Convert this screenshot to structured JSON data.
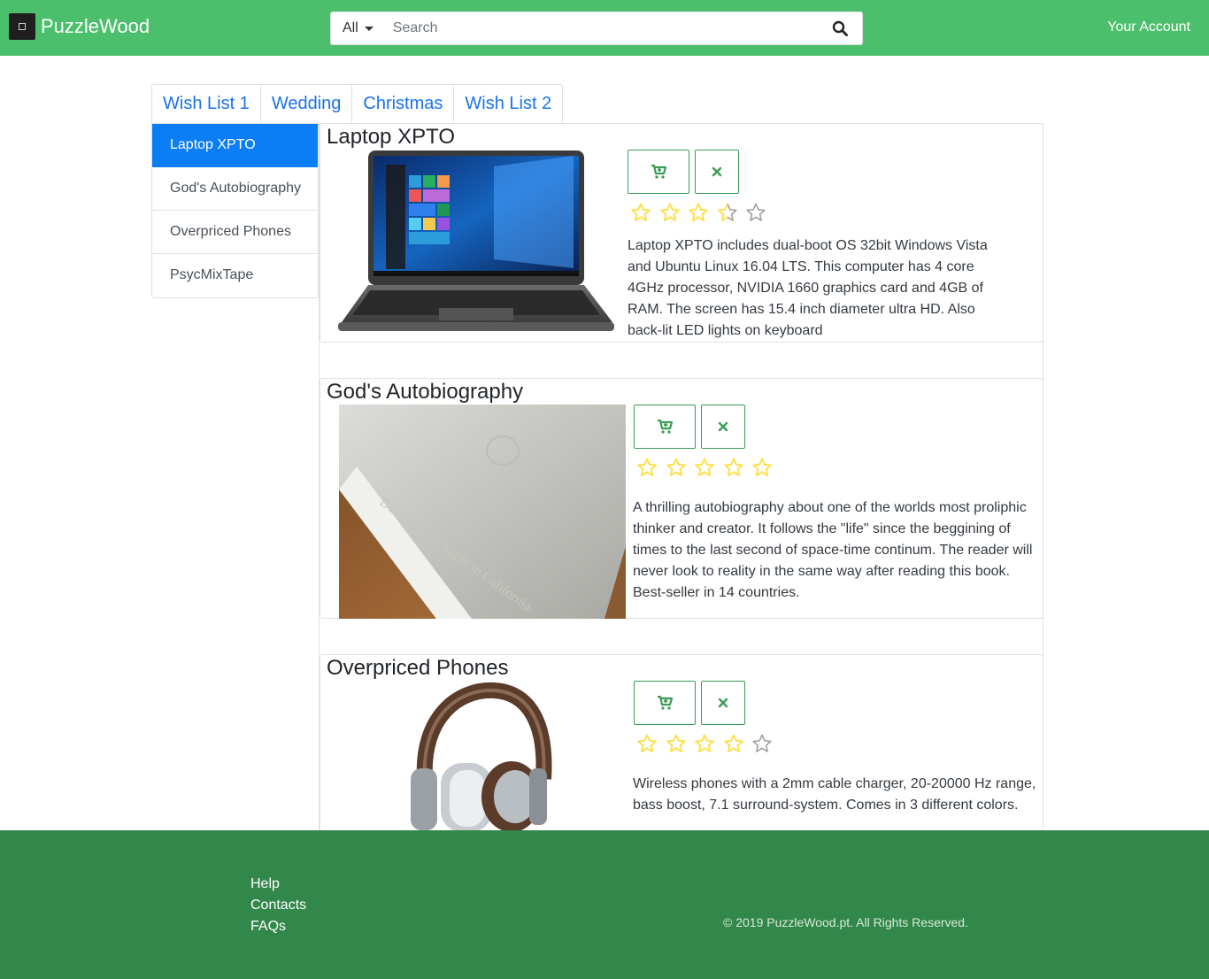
{
  "navbar": {
    "brand": "PuzzleWood",
    "search_category": "All",
    "search_placeholder": "Search",
    "account_label": "Your Account"
  },
  "tabs": [
    {
      "label": "Wish List 1"
    },
    {
      "label": "Wedding"
    },
    {
      "label": "Christmas"
    },
    {
      "label": "Wish List 2"
    }
  ],
  "sidebar": {
    "items": [
      {
        "label": "Laptop XPTO",
        "active": true
      },
      {
        "label": "God's Autobiography",
        "active": false
      },
      {
        "label": "Overpriced Phones",
        "active": false
      },
      {
        "label": "PsycMixTape",
        "active": false
      }
    ]
  },
  "products": [
    {
      "title": "Laptop XPTO",
      "rating": 3.5,
      "rating_max": 5,
      "description": "Laptop XPTO includes dual-boot OS 32bit Windows Vista and Ubuntu Linux 16.04 LTS. This computer has 4 core 4GHz processor, NVIDIA 1660 graphics card and 4GB of RAM. The screen has 15.4 inch diameter ultra HD. Also back-lit LED lights on keyboard"
    },
    {
      "title": "God's Autobiography",
      "rating": 5,
      "rating_max": 5,
      "description": "A thrilling autobiography about one of the worlds most proliphic thinker and creator. It follows the \"life\" since the beggining of times to the last second of space-time continum. The reader will never look to reality in the same way after reading this book. Best-seller in 14 countries.",
      "cover_text": "Designed by Apple in California"
    },
    {
      "title": "Overpriced Phones",
      "rating": 4,
      "rating_max": 5,
      "description": "Wireless phones with a 2mm cable charger, 20-20000 Hz range, bass boost, 7.1 surround-system. Comes in 3 different colors."
    }
  ],
  "footer": {
    "links": [
      {
        "label": "Help"
      },
      {
        "label": "Contacts"
      },
      {
        "label": "FAQs"
      }
    ],
    "copyright": "© 2019 PuzzleWood.pt. All Rights Reserved."
  },
  "colors": {
    "navbar": "#4bbf6b",
    "footer": "#32874a",
    "active_item": "#0b7df5",
    "link": "#1a73e8",
    "button_border": "#3a9c55",
    "star_fill": "#ffe14d",
    "star_empty": "#a0a0a0"
  },
  "icons": {
    "search": "search-icon",
    "cart": "cart-icon",
    "remove": "close-icon",
    "caret": "caret-down-icon",
    "logo": "brand-logo-icon"
  }
}
